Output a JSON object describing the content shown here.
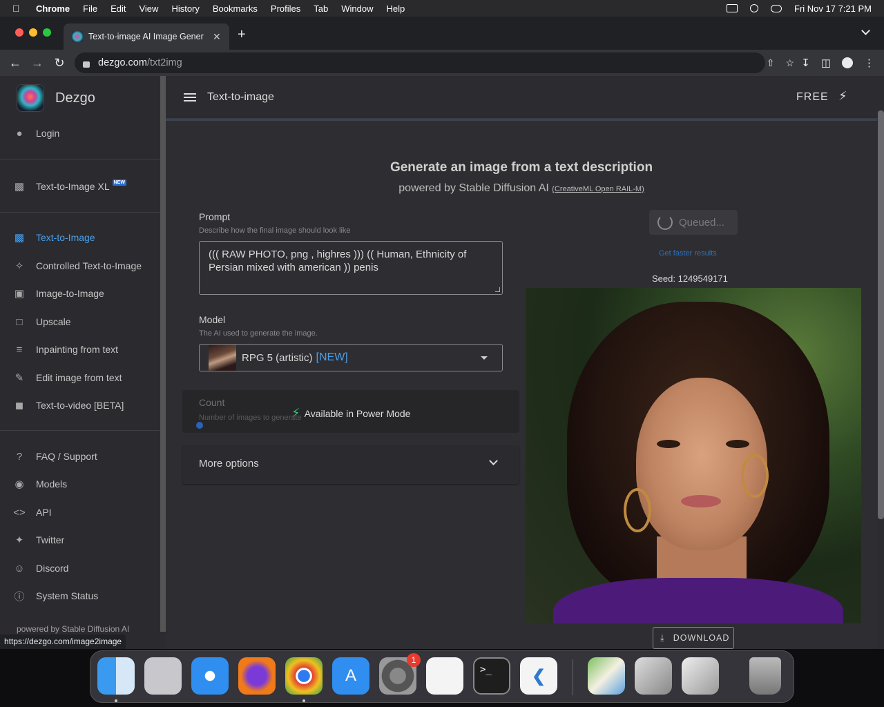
{
  "menubar": {
    "apple": "",
    "items": [
      "Chrome",
      "File",
      "Edit",
      "View",
      "History",
      "Bookmarks",
      "Profiles",
      "Tab",
      "Window",
      "Help"
    ],
    "clock": "Fri Nov 17  7:21 PM"
  },
  "browser": {
    "tab_title": "Text-to-image AI Image Gener",
    "tab_close": "✕",
    "new_tab": "+",
    "url_host": "dezgo.com",
    "url_path": "/txt2img",
    "status_url": "https://dezgo.com/image2image"
  },
  "sidebar": {
    "brand": "Dezgo",
    "login": "Login",
    "xl_item": "Text-to-Image XL",
    "new_badge": "NEW",
    "tools": [
      {
        "label": "Text-to-Image",
        "icon": "chat-icon"
      },
      {
        "label": "Controlled Text-to-Image",
        "icon": "controls-icon"
      },
      {
        "label": "Image-to-Image",
        "icon": "image-icon"
      },
      {
        "label": "Upscale",
        "icon": "upscale-icon"
      },
      {
        "label": "Inpainting from text",
        "icon": "inpaint-icon"
      },
      {
        "label": "Edit image from text",
        "icon": "edit-icon"
      },
      {
        "label": "Text-to-video [BETA]",
        "icon": "video-icon"
      }
    ],
    "links": [
      {
        "label": "FAQ / Support",
        "icon": "question-icon"
      },
      {
        "label": "Models",
        "icon": "models-icon"
      },
      {
        "label": "API",
        "icon": "code-icon"
      },
      {
        "label": "Twitter",
        "icon": "twitter-icon"
      },
      {
        "label": "Discord",
        "icon": "discord-icon"
      },
      {
        "label": "System Status",
        "icon": "info-icon"
      }
    ],
    "footer": "powered by Stable Diffusion AI"
  },
  "topbar": {
    "title": "Text-to-image",
    "plan": "FREE"
  },
  "main": {
    "heading": "Generate an image from a text description",
    "subheading": "powered by Stable Diffusion AI",
    "license": "(CreativeML Open RAIL-M)",
    "prompt_label": "Prompt",
    "prompt_hint": "Describe how the final image should look like",
    "prompt_value": "((( RAW PHOTO, png , highres ))) (( Human, Ethnicity of Persian mixed with american )) penis",
    "model_label": "Model",
    "model_hint": "The AI used to generate the image.",
    "model_value": "RPG 5 (artistic)",
    "model_new": "[NEW]",
    "count_label": "Count",
    "count_hint": "Number of images to generate",
    "power_mode": "Available in Power Mode",
    "more_options": "More options",
    "queued": "Queued...",
    "faster": "Get faster results",
    "seed": "Seed: 1249549171",
    "download": "DOWNLOAD"
  },
  "dock": {
    "apps": [
      "Finder",
      "Launchpad",
      "Safari",
      "Firefox",
      "Chrome",
      "App Store",
      "System Settings",
      "TextEdit",
      "Terminal",
      "VS Code",
      "Maps",
      "Disk Utility",
      "Disk Diagnostics",
      "Trash"
    ],
    "settings_badge": "1",
    "terminal_glyph": ">_"
  },
  "colors": {
    "accent": "#4c9ee8",
    "power_bolt": "#2ec47a",
    "background": "#2e2e32"
  }
}
